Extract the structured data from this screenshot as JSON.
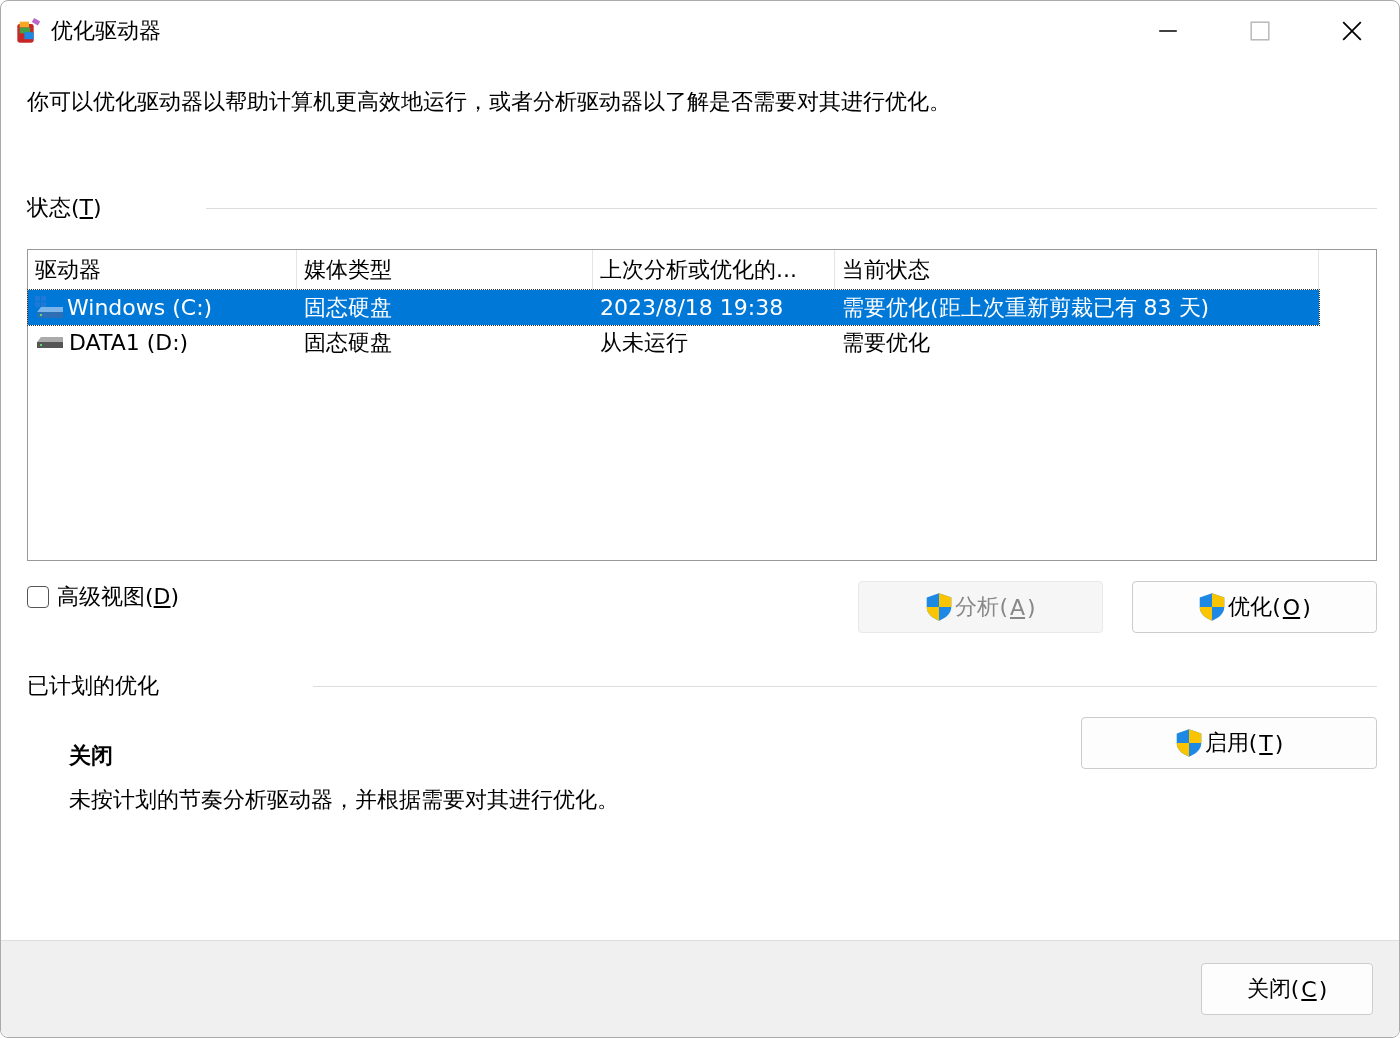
{
  "window": {
    "title": "优化驱动器"
  },
  "intro": "你可以优化驱动器以帮助计算机更高效地运行，或者分析驱动器以了解是否需要对其进行优化。",
  "status_section": {
    "label": {
      "before": "状态(",
      "key": "T",
      "after": ")"
    }
  },
  "table": {
    "columns": [
      "驱动器",
      "媒体类型",
      "上次分析或优化的...",
      "当前状态"
    ],
    "rows": [
      {
        "kind": "system",
        "cells": [
          "Windows (C:)",
          "固态硬盘",
          "2023/8/18 19:38",
          "需要优化(距上次重新剪裁已有 83 天)"
        ],
        "selected": true
      },
      {
        "kind": "data",
        "cells": [
          "DATA1 (D:)",
          "固态硬盘",
          "从未运行",
          "需要优化"
        ],
        "selected": false
      }
    ]
  },
  "advanced_view": {
    "label": {
      "before": "高级视图(",
      "key": "D",
      "after": ")"
    },
    "checked": false
  },
  "buttons": [
    {
      "label": {
        "before": "分析(",
        "key": "A",
        "after": ")"
      },
      "disabled": true
    },
    {
      "label": {
        "before": "优化(",
        "key": "O",
        "after": ")"
      },
      "disabled": false
    }
  ],
  "schedule_section": {
    "label": "已计划的优化",
    "state": "关闭",
    "description": "未按计划的节奏分析驱动器，并根据需要对其进行优化。",
    "button": {
      "label": {
        "before": "启用(",
        "key": "T",
        "after": ")"
      },
      "disabled": false
    }
  },
  "footer": {
    "close_button": {
      "label": {
        "before": "关闭(",
        "key": "C",
        "after": ")"
      }
    }
  }
}
